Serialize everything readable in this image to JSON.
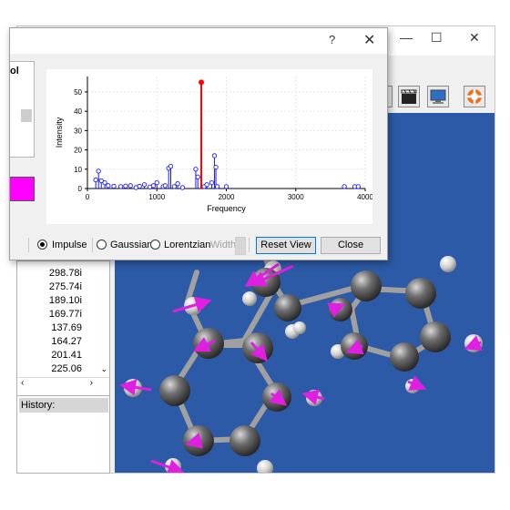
{
  "main_window": {
    "controls": {
      "minimize": "—",
      "maximize": "☐",
      "close": "✕"
    },
    "toolbar_icons": [
      "movie-icon",
      "screen-icon",
      "help-lifebuoy-icon"
    ]
  },
  "frequency_list": [
    "298.78i",
    "275.74i",
    "189.10i",
    "169.77i",
    "137.69",
    "164.27",
    "201.41",
    "225.06"
  ],
  "history": {
    "label": "History:"
  },
  "dialog": {
    "help": "?",
    "close": "✕",
    "radio_impulse": "Impulse",
    "radio_gaussian": "Gaussian",
    "radio_lorentzian": "Lorentzian",
    "width_label": "Width",
    "reset_view": "Reset View",
    "close_button": "Close",
    "selected_mode": "Impulse"
  },
  "chart_data": {
    "type": "scatter",
    "xlabel": "Frequency",
    "ylabel": "Intensity",
    "xlim": [
      0,
      4000
    ],
    "ylim": [
      0,
      58
    ],
    "xticks": [
      0,
      1000,
      2000,
      3000,
      4000
    ],
    "yticks": [
      0,
      10,
      20,
      30,
      40,
      50
    ],
    "grid": true,
    "colors": {
      "impulse": "#1a1aff",
      "selected": "#ff0000"
    },
    "series": [
      {
        "values": [
          [
            120,
            4.5
          ],
          [
            160,
            9
          ],
          [
            200,
            4
          ],
          [
            250,
            3
          ],
          [
            300,
            1.5
          ],
          [
            380,
            1.2
          ],
          [
            480,
            1
          ],
          [
            550,
            1.3
          ],
          [
            620,
            1.5
          ],
          [
            700,
            0.5
          ],
          [
            750,
            1.2
          ],
          [
            820,
            2
          ],
          [
            900,
            0.8
          ],
          [
            950,
            1.5
          ],
          [
            1000,
            3
          ],
          [
            1090,
            1
          ],
          [
            1120,
            1.5
          ],
          [
            1170,
            10.5
          ],
          [
            1200,
            11.5
          ],
          [
            1250,
            1
          ],
          [
            1300,
            2.5
          ],
          [
            1370,
            0.5
          ],
          [
            1560,
            10
          ],
          [
            1590,
            6
          ],
          [
            1680,
            1
          ],
          [
            1720,
            2
          ],
          [
            1790,
            3
          ],
          [
            1830,
            17
          ],
          [
            1850,
            11
          ],
          [
            1870,
            1
          ],
          [
            2000,
            1
          ],
          [
            3700,
            1
          ],
          [
            3850,
            1
          ],
          [
            3900,
            1
          ]
        ]
      }
    ],
    "selected": {
      "x": 1640,
      "y": 55
    }
  },
  "viewport": {
    "background": "#2c5aa6",
    "atom_color": "#4a4a4a",
    "hydrogen_color": "#d8d8d8",
    "arrow_color": "#e020e0"
  }
}
